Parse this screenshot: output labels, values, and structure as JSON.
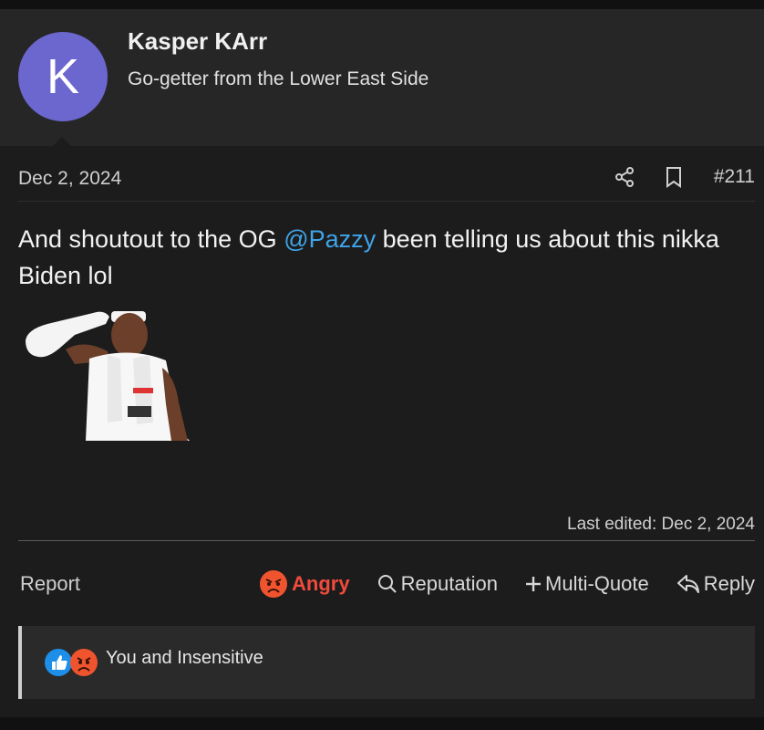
{
  "user": {
    "avatar_letter": "K",
    "name": "Kasper KArr",
    "title": "Go-getter from the Lower East Side"
  },
  "post": {
    "date": "Dec 2, 2024",
    "number": "#211",
    "body_before": "And shoutout to the OG ",
    "mention": "@Pazzy",
    "body_after": " been telling us about this nikka Biden lol",
    "last_edited": "Last edited: Dec 2, 2024"
  },
  "actions": {
    "report": "Report",
    "reaction": "Angry",
    "reputation": "Reputation",
    "multi_quote": "Multi-Quote",
    "reply": "Reply"
  },
  "reactions_summary": {
    "text": "You and Insensitive",
    "icons": [
      "thumbs-up-icon",
      "angry-face-icon"
    ]
  },
  "colors": {
    "avatar_bg": "#6c67cf",
    "mention": "#3fa4ea",
    "angry": "#f04b3c",
    "like": "#1d8fe8"
  }
}
